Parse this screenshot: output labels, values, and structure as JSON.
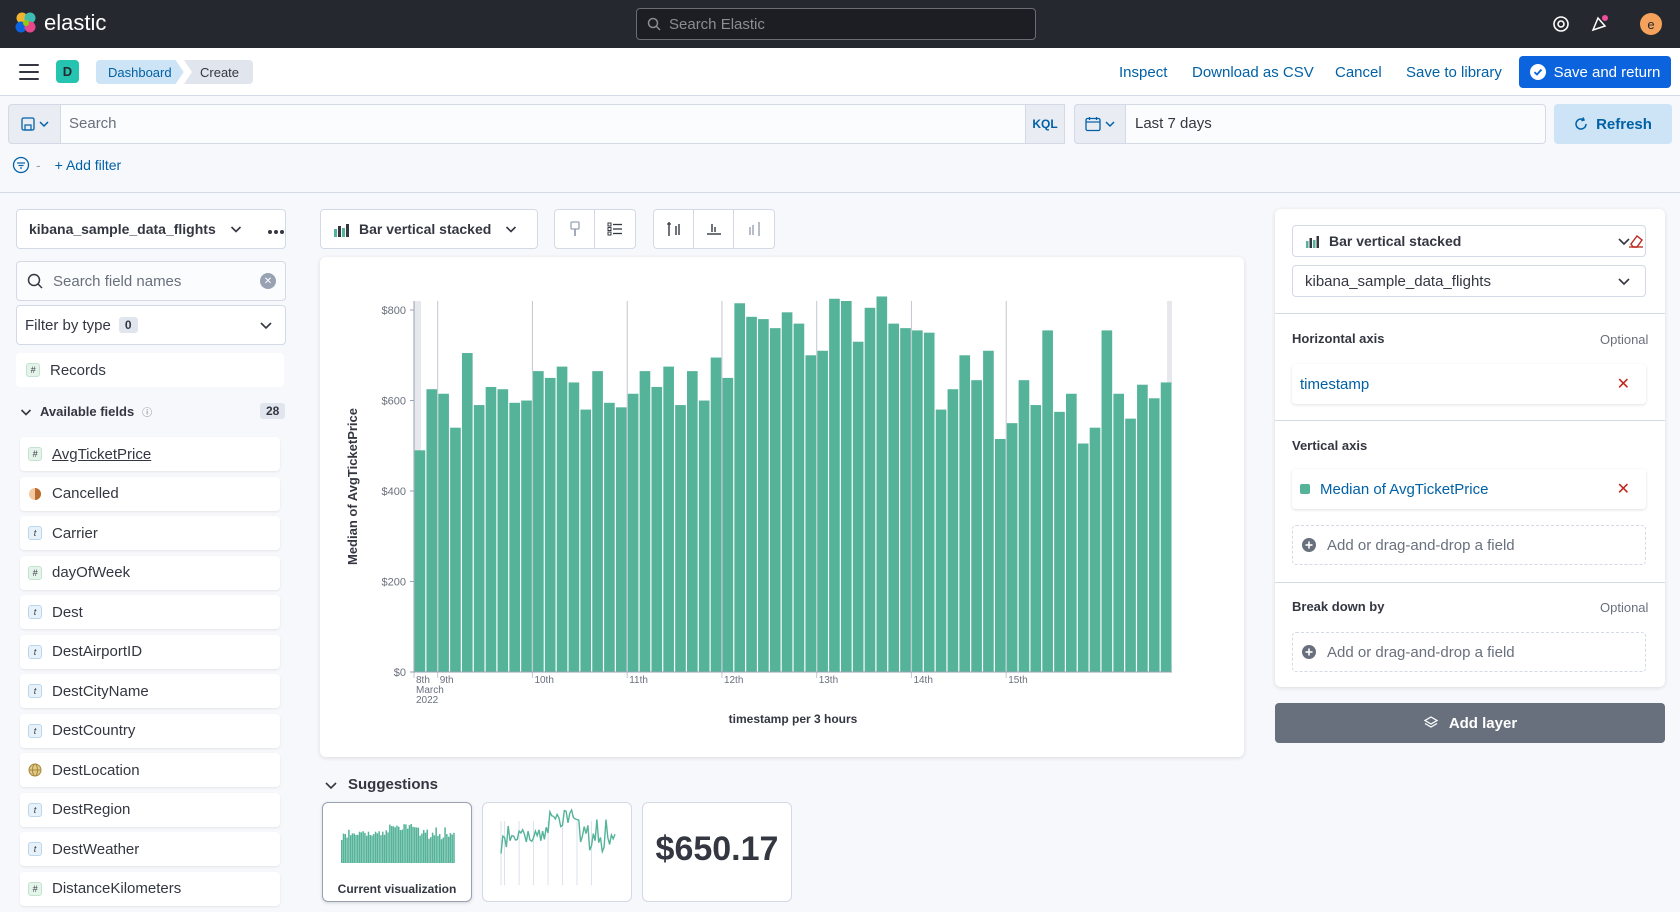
{
  "header": {
    "brand": "elastic",
    "search_placeholder": "Search Elastic",
    "avatar_initial": "e"
  },
  "nav": {
    "space_badge": "D",
    "breadcrumbs": [
      "Dashboard",
      "Create"
    ],
    "actions": [
      "Inspect",
      "Download as CSV",
      "Cancel",
      "Save to library"
    ],
    "primary_action": "Save and return"
  },
  "query": {
    "placeholder": "Search",
    "language": "KQL",
    "time_range": "Last 7 days",
    "refresh_label": "Refresh",
    "add_filter": "+ Add filter"
  },
  "left_panel": {
    "index_pattern": "kibana_sample_data_flights",
    "field_search_placeholder": "Search field names",
    "filter_by_type": "Filter by type",
    "filter_count": "0",
    "records_label": "Records",
    "available_label": "Available fields",
    "available_count": "28",
    "fields": [
      {
        "name": "AvgTicketPrice",
        "type": "#"
      },
      {
        "name": "Cancelled",
        "type": "bool"
      },
      {
        "name": "Carrier",
        "type": "t"
      },
      {
        "name": "dayOfWeek",
        "type": "#"
      },
      {
        "name": "Dest",
        "type": "t"
      },
      {
        "name": "DestAirportID",
        "type": "t"
      },
      {
        "name": "DestCityName",
        "type": "t"
      },
      {
        "name": "DestCountry",
        "type": "t"
      },
      {
        "name": "DestLocation",
        "type": "geo"
      },
      {
        "name": "DestRegion",
        "type": "t"
      },
      {
        "name": "DestWeather",
        "type": "t"
      },
      {
        "name": "DistanceKilometers",
        "type": "#"
      }
    ]
  },
  "workspace": {
    "vis_type": "Bar vertical stacked",
    "suggestions_label": "Suggestions",
    "suggestion_current": "Current visualization",
    "suggestion_metric": "$650.17"
  },
  "chart_data": {
    "type": "bar",
    "xlabel": "timestamp per 3 hours",
    "ylabel": "Median of AvgTicketPrice",
    "ylim": [
      0,
      800
    ],
    "yticks": [
      "$0",
      "$200",
      "$400",
      "$600",
      "$800"
    ],
    "xticks": [
      "8th March 2022",
      "9th",
      "10th",
      "11th",
      "12th",
      "13th",
      "14th",
      "15th"
    ],
    "color": "#54b399",
    "values": [
      490,
      625,
      615,
      540,
      705,
      590,
      630,
      625,
      595,
      600,
      665,
      650,
      675,
      640,
      580,
      665,
      595,
      585,
      615,
      665,
      630,
      675,
      590,
      665,
      600,
      695,
      650,
      815,
      785,
      780,
      760,
      795,
      770,
      700,
      710,
      825,
      820,
      730,
      805,
      830,
      770,
      760,
      755,
      750,
      580,
      625,
      700,
      645,
      710,
      515,
      550,
      645,
      590,
      755,
      575,
      615,
      505,
      540,
      755,
      615,
      560,
      635,
      605,
      640
    ]
  },
  "right_panel": {
    "vis_type": "Bar vertical stacked",
    "index_pattern": "kibana_sample_data_flights",
    "horizontal_axis": "Horizontal axis",
    "optional": "Optional",
    "horizontal_field": "timestamp",
    "vertical_axis": "Vertical axis",
    "vertical_field": "Median of AvgTicketPrice",
    "add_field": "Add or drag-and-drop a field",
    "break_down": "Break down by",
    "add_layer": "Add layer"
  }
}
